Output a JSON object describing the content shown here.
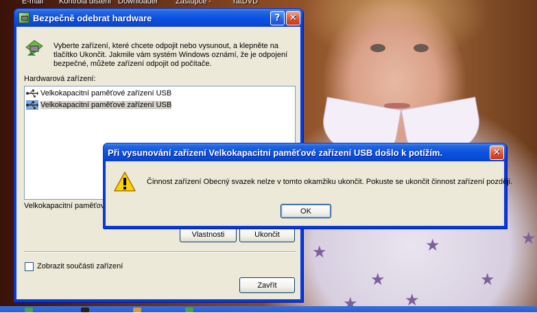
{
  "desktop": {
    "icon_labels": [
      "E-mail",
      "Kontrola disteni",
      "Downloader",
      "Zástupce -",
      "ratDVD"
    ]
  },
  "main_window": {
    "title": "Bezpečně odebrat hardware",
    "instructions_line1": "Vyberte zařízení, které chcete odpojit nebo vysunout, a klepněte na",
    "instructions_line2": "tlačítko Ukončit. Jakmile vám systém Windows oznámí, že je odpojení",
    "instructions_line3": "bezpečné, můžete zařízení odpojit od počítače.",
    "list_label": "Hardwarová zařízení:",
    "devices": [
      {
        "label": "Velkokapacitní paměťové zařízení USB",
        "selected": false
      },
      {
        "label": "Velkokapacitní paměťové zařízení USB",
        "selected": true
      }
    ],
    "status_text": "Velkokapacitní paměťov",
    "properties_button": "Vlastnosti",
    "stop_button": "Ukončit",
    "show_components_label": "Zobrazit součásti zařízení",
    "show_components_checked": false,
    "close_button": "Zavřít"
  },
  "error_dialog": {
    "title": "Při vysunování zařízení Velkokapacitní paměťové zařízení USB došlo k potížím.",
    "message": "Činnost zařízení Obecný svazek nelze v tomto okamžiku ukončit. Pokuste se ukončit činnost zařízení později.",
    "ok_button": "OK",
    "icon": "warning-icon"
  },
  "colors": {
    "title_bar": "#0a52e0",
    "window_face": "#ece9d8",
    "close_button": "#e2552c",
    "selection": "#d4d0c8"
  }
}
